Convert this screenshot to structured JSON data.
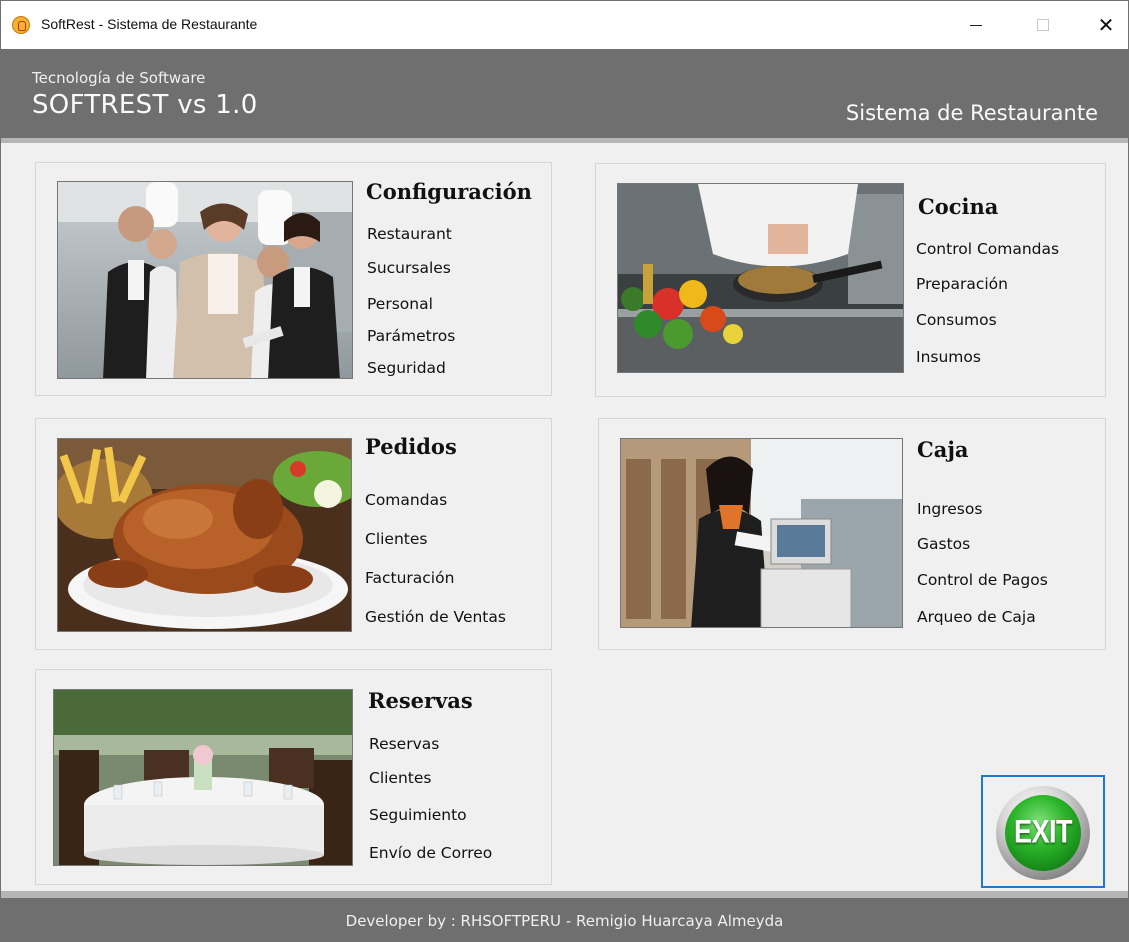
{
  "window": {
    "title": "SoftRest - Sistema de Restaurante",
    "controls": {
      "minimize": "minimize",
      "maximize": "maximize",
      "close": "✕"
    }
  },
  "header": {
    "subtitle": "Tecnología de Software",
    "title": "SOFTREST vs 1.0",
    "right_text": "Sistema de Restaurante"
  },
  "modules": {
    "configuracion": {
      "title": "Configuración",
      "image": "restaurant-staff-photo",
      "items": [
        "Restaurant",
        "Sucursales",
        "Personal",
        "Parámetros",
        "Seguridad"
      ]
    },
    "cocina": {
      "title": "Cocina",
      "image": "chef-cooking-photo",
      "items": [
        "Control Comandas",
        "Preparación",
        "Consumos",
        "Insumos"
      ]
    },
    "pedidos": {
      "title": "Pedidos",
      "image": "roast-chicken-photo",
      "items": [
        "Comandas",
        "Clientes",
        "Facturación",
        "Gestión de Ventas"
      ]
    },
    "caja": {
      "title": "Caja",
      "image": "cashier-photo",
      "items": [
        "Ingresos",
        "Gastos",
        "Control de Pagos",
        "Arqueo de Caja"
      ]
    },
    "reservas": {
      "title": "Reservas",
      "image": "dining-table-photo",
      "items": [
        "Reservas",
        "Clientes",
        "Seguimiento",
        "Envío de Correo"
      ]
    }
  },
  "exit_button": {
    "label": "EXIT",
    "icon": "exit-icon"
  },
  "footer": {
    "text": "Developer by : RHSOFTPERU - Remigio Huarcaya Almeyda"
  },
  "colors": {
    "header_bg": "#6f6f6f",
    "body_bg": "#f0f0f0",
    "accent_border": "#1c79cf",
    "exit_green": "#2cb52a"
  }
}
